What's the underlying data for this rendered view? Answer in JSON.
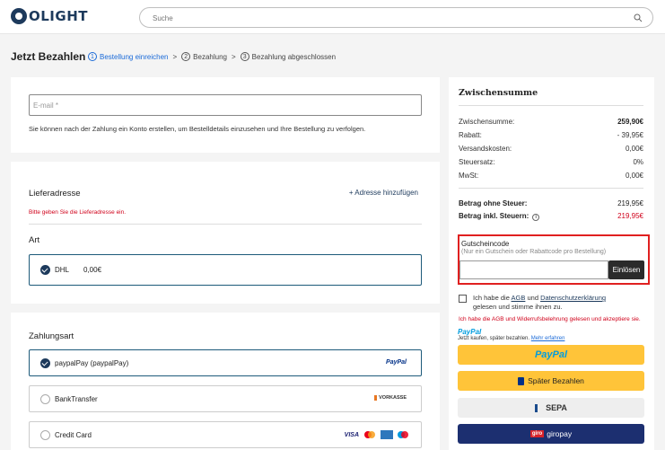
{
  "header": {
    "logo_text": "OLIGHT",
    "search_placeholder": "Suche"
  },
  "page": {
    "title": "Jetzt Bezahlen",
    "steps": [
      {
        "num": "1",
        "label": "Bestellung einreichen"
      },
      {
        "num": "2",
        "label": "Bezahlung"
      },
      {
        "num": "3",
        "label": "Bezahlung abgeschlossen"
      }
    ],
    "separator": ">"
  },
  "email": {
    "placeholder": "E-mail *",
    "hint": "Sie können nach der Zahlung ein Konto erstellen, um Bestelldetails einzusehen und Ihre Bestellung zu verfolgen."
  },
  "address": {
    "heading": "Lieferadresse",
    "add_link": "+ Adresse hinzufügen",
    "error": "Bitte geben Sie die Lieferadresse ein."
  },
  "shipping": {
    "heading": "Art",
    "option_name": "DHL",
    "option_price": "0,00€"
  },
  "payment": {
    "heading": "Zahlungsart",
    "options": [
      {
        "label": "paypalPay (paypalPay)",
        "logo": "PayPal",
        "selected": true
      },
      {
        "label": "BankTransfer",
        "logo": "VORKASSE",
        "selected": false
      },
      {
        "label": "Credit Card",
        "logo": "VISA",
        "selected": false
      }
    ]
  },
  "summary": {
    "title": "Zwischensumme",
    "rows": [
      {
        "label": "Zwischensumme:",
        "value": "259,90€"
      },
      {
        "label": "Rabatt:",
        "value": "- 39,95€"
      },
      {
        "label": "Versandskosten:",
        "value": "0,00€"
      },
      {
        "label": "Steuersatz:",
        "value": "0%"
      },
      {
        "label": "MwSt:",
        "value": "0,00€"
      }
    ],
    "net_label": "Betrag ohne Steuer:",
    "net_value": "219,95€",
    "gross_label": "Betrag inkl. Steuern:",
    "gross_value": "219,95€"
  },
  "voucher": {
    "title": "Gutscheincode",
    "subtitle": "(Nur ein Gutschein oder Rabattcode pro Bestellung)",
    "input_value": "",
    "button": "Einlösen"
  },
  "agb": {
    "text_1": "Ich habe die ",
    "link_agb": "AGB",
    "text_2": " und ",
    "link_privacy": "Datenschutzerklärung",
    "text_3": "gelesen und stimme ihnen zu.",
    "error": "Ich habe die AGB und Widerrufsbelehrung gelesen und akzeptiere sie."
  },
  "paypal_later": {
    "logo": "PayPal",
    "text": "Jetzt kaufen, später bezahlen.",
    "link": "Mehr erfahren"
  },
  "buttons": {
    "paypal": "PayPal",
    "later": "Später Bezahlen",
    "sepa": "SEPA",
    "giropay": "giropay",
    "giro_badge": "giro"
  },
  "colors": {
    "brand": "#1d3a5c",
    "error": "#d0021b",
    "paypal_yellow": "#ffc439",
    "giropay_blue": "#1c2f70"
  }
}
